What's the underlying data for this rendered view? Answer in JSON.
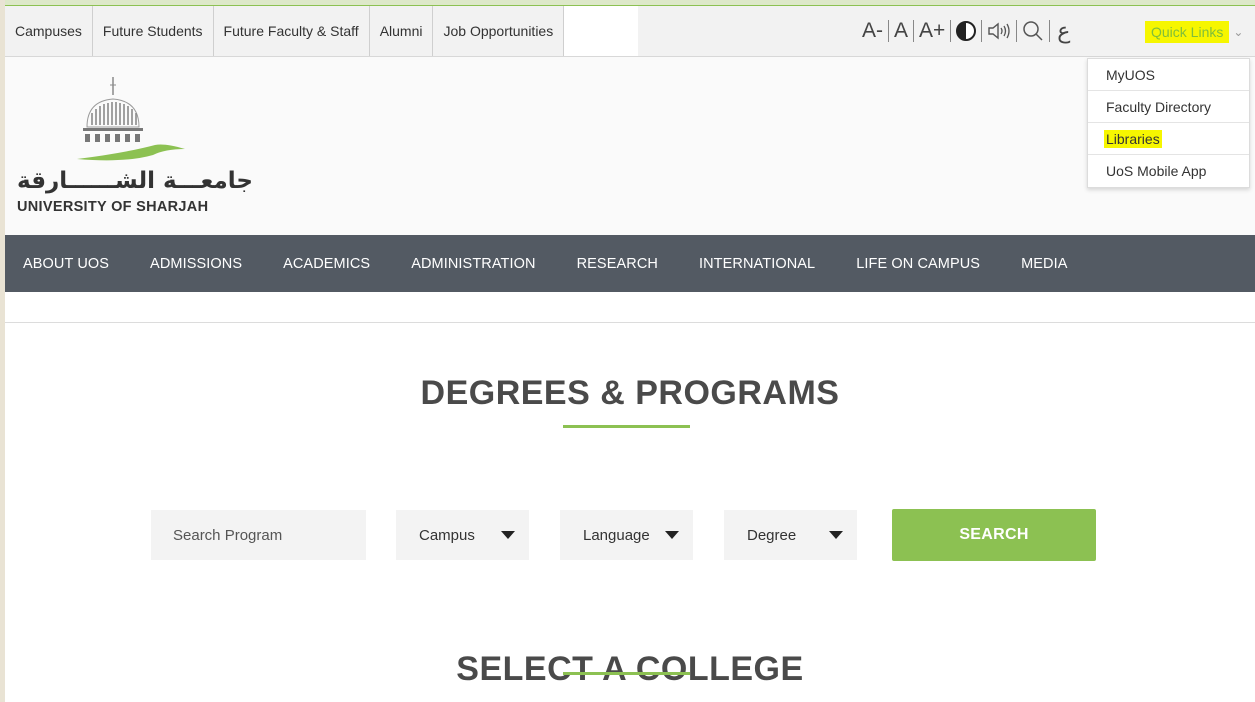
{
  "utility": {
    "links": [
      "Campuses",
      "Future Students",
      "Future Faculty & Staff",
      "Alumni",
      "Job Opportunities"
    ],
    "font_decrease": "A-",
    "font_reset": "A",
    "font_increase": "A+",
    "arabic_toggle": "ع",
    "quick_links_label": "Quick Links"
  },
  "quick_menu": {
    "items": [
      "MyUOS",
      "Faculty Directory",
      "Libraries",
      "UoS Mobile App"
    ]
  },
  "logo": {
    "arabic_name": "جامعـــة الشــــــارقة",
    "english_name": "UNIVERSITY OF SHARJAH"
  },
  "nav": {
    "items": [
      "ABOUT UOS",
      "ADMISSIONS",
      "ACADEMICS",
      "ADMINISTRATION",
      "RESEARCH",
      "INTERNATIONAL",
      "LIFE ON CAMPUS",
      "MEDIA"
    ]
  },
  "main": {
    "title": "DEGREES & PROGRAMS",
    "search_placeholder": "Search Program",
    "campus_select": "Campus",
    "language_select": "Language",
    "degree_select": "Degree",
    "search_button": "SEARCH",
    "college_title": "SELECT A COLLEGE"
  },
  "colors": {
    "accent_green": "#8cc152",
    "nav_bg": "#535a63",
    "highlight_yellow": "#f6f600"
  },
  "icons": [
    "contrast-icon",
    "speaker-icon",
    "search-icon",
    "chevron-down-icon",
    "dropdown-caret-icon"
  ]
}
